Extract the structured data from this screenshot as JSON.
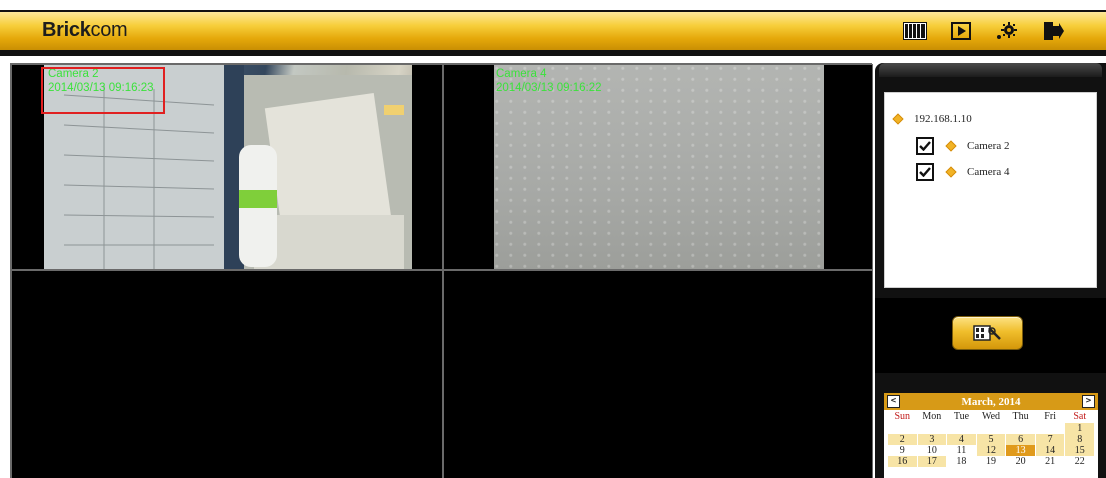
{
  "header": {
    "logo_bold": "Brick",
    "logo_light": "com",
    "icons": [
      "layout-icon",
      "playback-icon",
      "settings-icon",
      "logout-icon"
    ]
  },
  "videos": [
    {
      "camera": "Camera 2",
      "timestamp": "2014/03/13 09:16:23"
    },
    {
      "camera": "Camera 4",
      "timestamp": "2014/03/13 09:16:22"
    }
  ],
  "tree": {
    "host": "192.168.1.10",
    "cameras": [
      {
        "label": "Camera 2",
        "checked": true
      },
      {
        "label": "Camera 4",
        "checked": true
      }
    ]
  },
  "calendar": {
    "title": "March, 2014",
    "prev": "<",
    "next": ">",
    "weekdays": [
      "Sun",
      "Mon",
      "Tue",
      "Wed",
      "Thu",
      "Fri",
      "Sat"
    ],
    "weeks": [
      [
        "",
        "",
        "",
        "",
        "",
        "",
        "1"
      ],
      [
        "2",
        "3",
        "4",
        "5",
        "6",
        "7",
        "8"
      ],
      [
        "9",
        "10",
        "11",
        "12",
        "13",
        "14",
        "15"
      ],
      [
        "16",
        "17",
        "18",
        "19",
        "20",
        "21",
        "22"
      ]
    ],
    "recorded_days": [
      "1",
      "2",
      "3",
      "4",
      "5",
      "6",
      "7",
      "8",
      "12",
      "13",
      "14",
      "15",
      "16",
      "17"
    ],
    "selected_day": "13"
  },
  "colors": {
    "accent": "#f0be2c",
    "overlay_text": "#3be23b",
    "selection": "#e02020",
    "today": "#e09a1c"
  }
}
